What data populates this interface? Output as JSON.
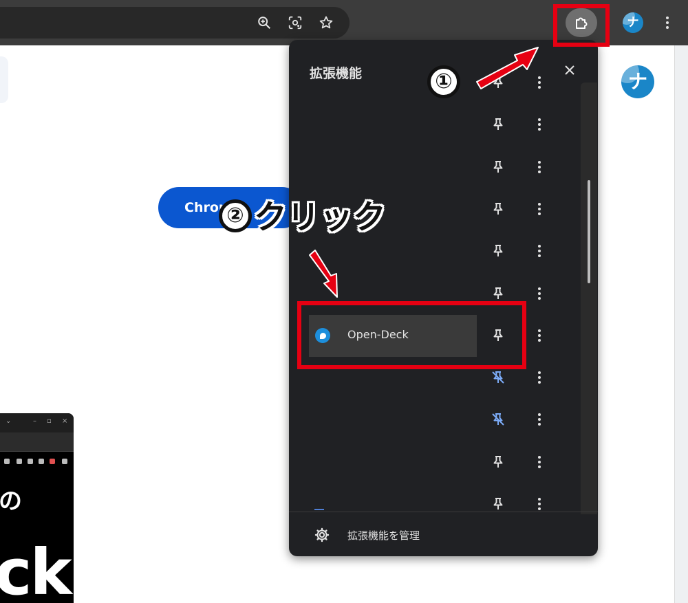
{
  "toolbar": {
    "icons": [
      "zoom-icon",
      "lens-icon",
      "bookmark-star-icon",
      "extensions-puzzle-icon",
      "profile-avatar",
      "menu-kebab-icon"
    ],
    "avatar_letter": "ナ"
  },
  "page": {
    "button_label": "Chrome",
    "thumbnail": {
      "text_top": "の",
      "text_big": "ck"
    }
  },
  "extensions_panel": {
    "title": "拡張機能",
    "rows": [
      {
        "label": "",
        "pinned": true
      },
      {
        "label": "",
        "pinned": true
      },
      {
        "label": "",
        "pinned": true
      },
      {
        "label": "",
        "pinned": true
      },
      {
        "label": "",
        "pinned": true
      },
      {
        "label": "",
        "pinned": true
      },
      {
        "label": "Open-Deck",
        "pinned": true,
        "highlighted": true
      },
      {
        "label": "",
        "pinned": false
      },
      {
        "label": "",
        "pinned": false
      },
      {
        "label": "",
        "pinned": true
      },
      {
        "label": "",
        "pinned": true
      }
    ],
    "manage_label": "拡張機能を管理"
  },
  "annotations": {
    "step1_badge": "①",
    "step2_badge": "②",
    "step2_text": "クリック",
    "accent_color": "#e60012"
  }
}
